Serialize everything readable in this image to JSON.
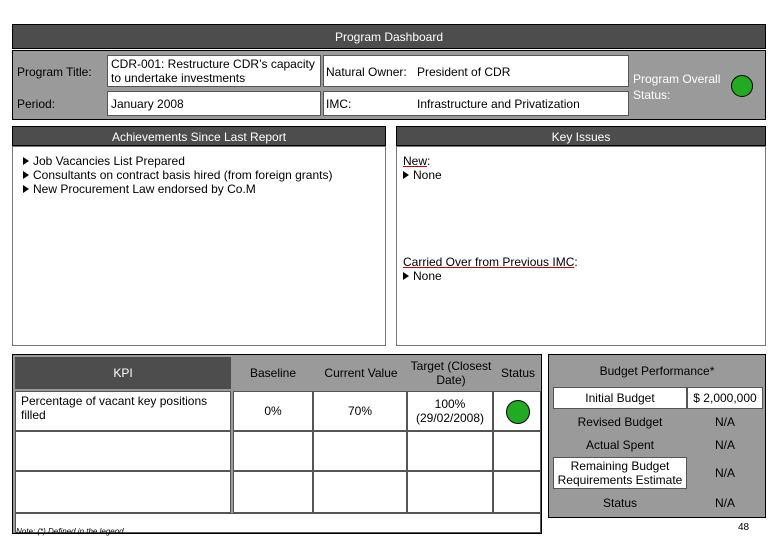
{
  "header": {
    "title": "Program Dashboard"
  },
  "program": {
    "title_label": "Program Title:",
    "title_value": "CDR-001: Restructure CDR’s capacity to undertake investments",
    "period_label": "Period:",
    "period_value": "January 2008",
    "owner_label": "Natural Owner:",
    "owner_value": "President of CDR",
    "imc_label": "IMC:",
    "imc_value": "Infrastructure and Privatization",
    "status_label": "Program Overall Status:",
    "status_color": "#22aa22"
  },
  "achievements": {
    "heading": "Achievements Since Last Report",
    "items": [
      "Job Vacancies List Prepared",
      "Consultants on contract basis hired (from foreign grants)",
      "New Procurement Law endorsed by Co.M"
    ]
  },
  "key_issues": {
    "heading": "Key Issues",
    "new_label": "New",
    "new_items": [
      "None"
    ],
    "carried_label": "Carried Over from Previous IMC",
    "carried_items": [
      "None"
    ]
  },
  "kpi": {
    "headers": {
      "kpi": "KPI",
      "baseline": "Baseline",
      "current": "Current Value",
      "target": "Target (Closest Date)",
      "status": "Status"
    },
    "rows": [
      {
        "kpi": "Percentage of vacant key positions filled",
        "baseline": "0%",
        "current": "70%",
        "target": "100% (29/02/2008)",
        "status_color": "#22aa22"
      }
    ]
  },
  "budget": {
    "heading": "Budget Performance*",
    "rows": [
      {
        "label": "Initial Budget",
        "value": "$ 2,000,000"
      },
      {
        "label": "Revised Budget",
        "value": "N/A"
      },
      {
        "label": "Actual Spent",
        "value": "N/A"
      },
      {
        "label": "Remaining Budget Requirements Estimate",
        "value": "N/A"
      },
      {
        "label": "Status",
        "value": "N/A"
      }
    ]
  },
  "footer": {
    "note": "Note: (*) Defined in the legend",
    "page_number": "48"
  }
}
